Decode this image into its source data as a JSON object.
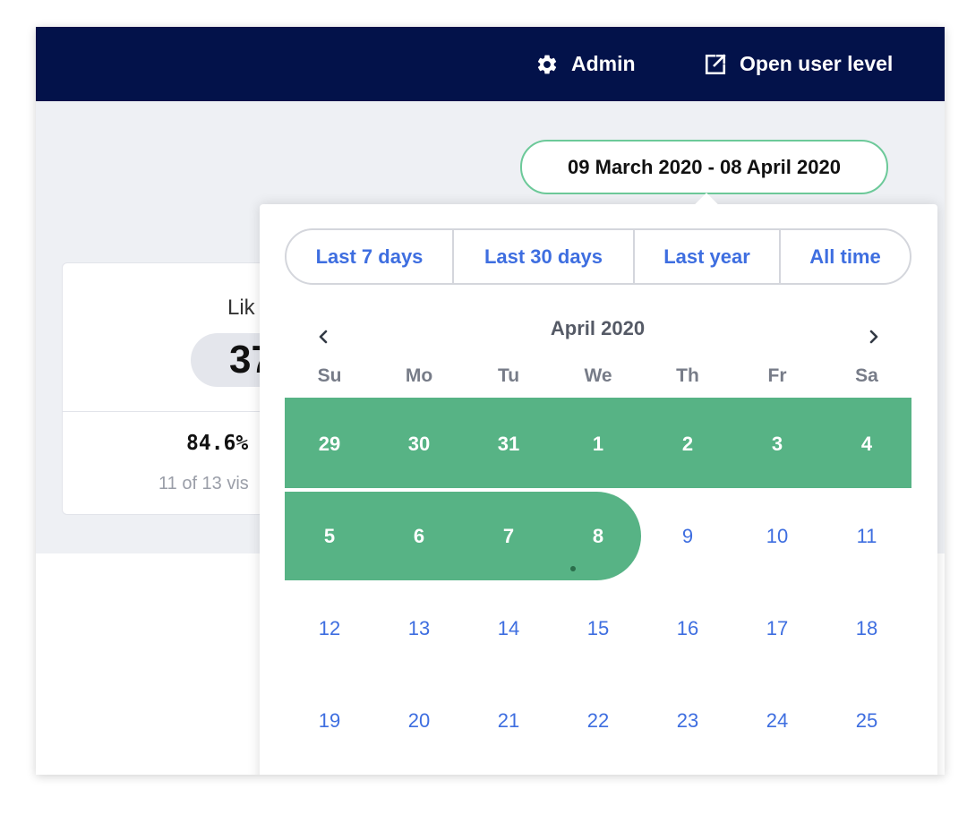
{
  "topbar": {
    "admin_label": "Admin",
    "admin_icon": "gear-icon",
    "open_user_label": "Open user level",
    "open_user_icon": "external-link-icon",
    "background": "#03124a"
  },
  "date_range": {
    "label": "09 March 2020 - 08 April 2020",
    "border_color": "#6cc999"
  },
  "card": {
    "title": "Lik",
    "value": "37",
    "percent": "84.6%",
    "subtext": "11 of 13 vis"
  },
  "date_picker": {
    "presets": [
      "Last 7 days",
      "Last 30 days",
      "Last year",
      "All time"
    ],
    "month_title": "April 2020",
    "prev_icon": "chevron-left-icon",
    "next_icon": "chevron-right-icon",
    "weekdays": [
      "Su",
      "Mo",
      "Tu",
      "We",
      "Th",
      "Fr",
      "Sa"
    ],
    "weeks": [
      [
        "29",
        "30",
        "31",
        "1",
        "2",
        "3",
        "4"
      ],
      [
        "5",
        "6",
        "7",
        "8",
        "9",
        "10",
        "11"
      ],
      [
        "12",
        "13",
        "14",
        "15",
        "16",
        "17",
        "18"
      ],
      [
        "19",
        "20",
        "21",
        "22",
        "23",
        "24",
        "25"
      ]
    ],
    "selection_color": "#57b385",
    "day_color": "#3e6ee0",
    "selected_end": "8"
  }
}
